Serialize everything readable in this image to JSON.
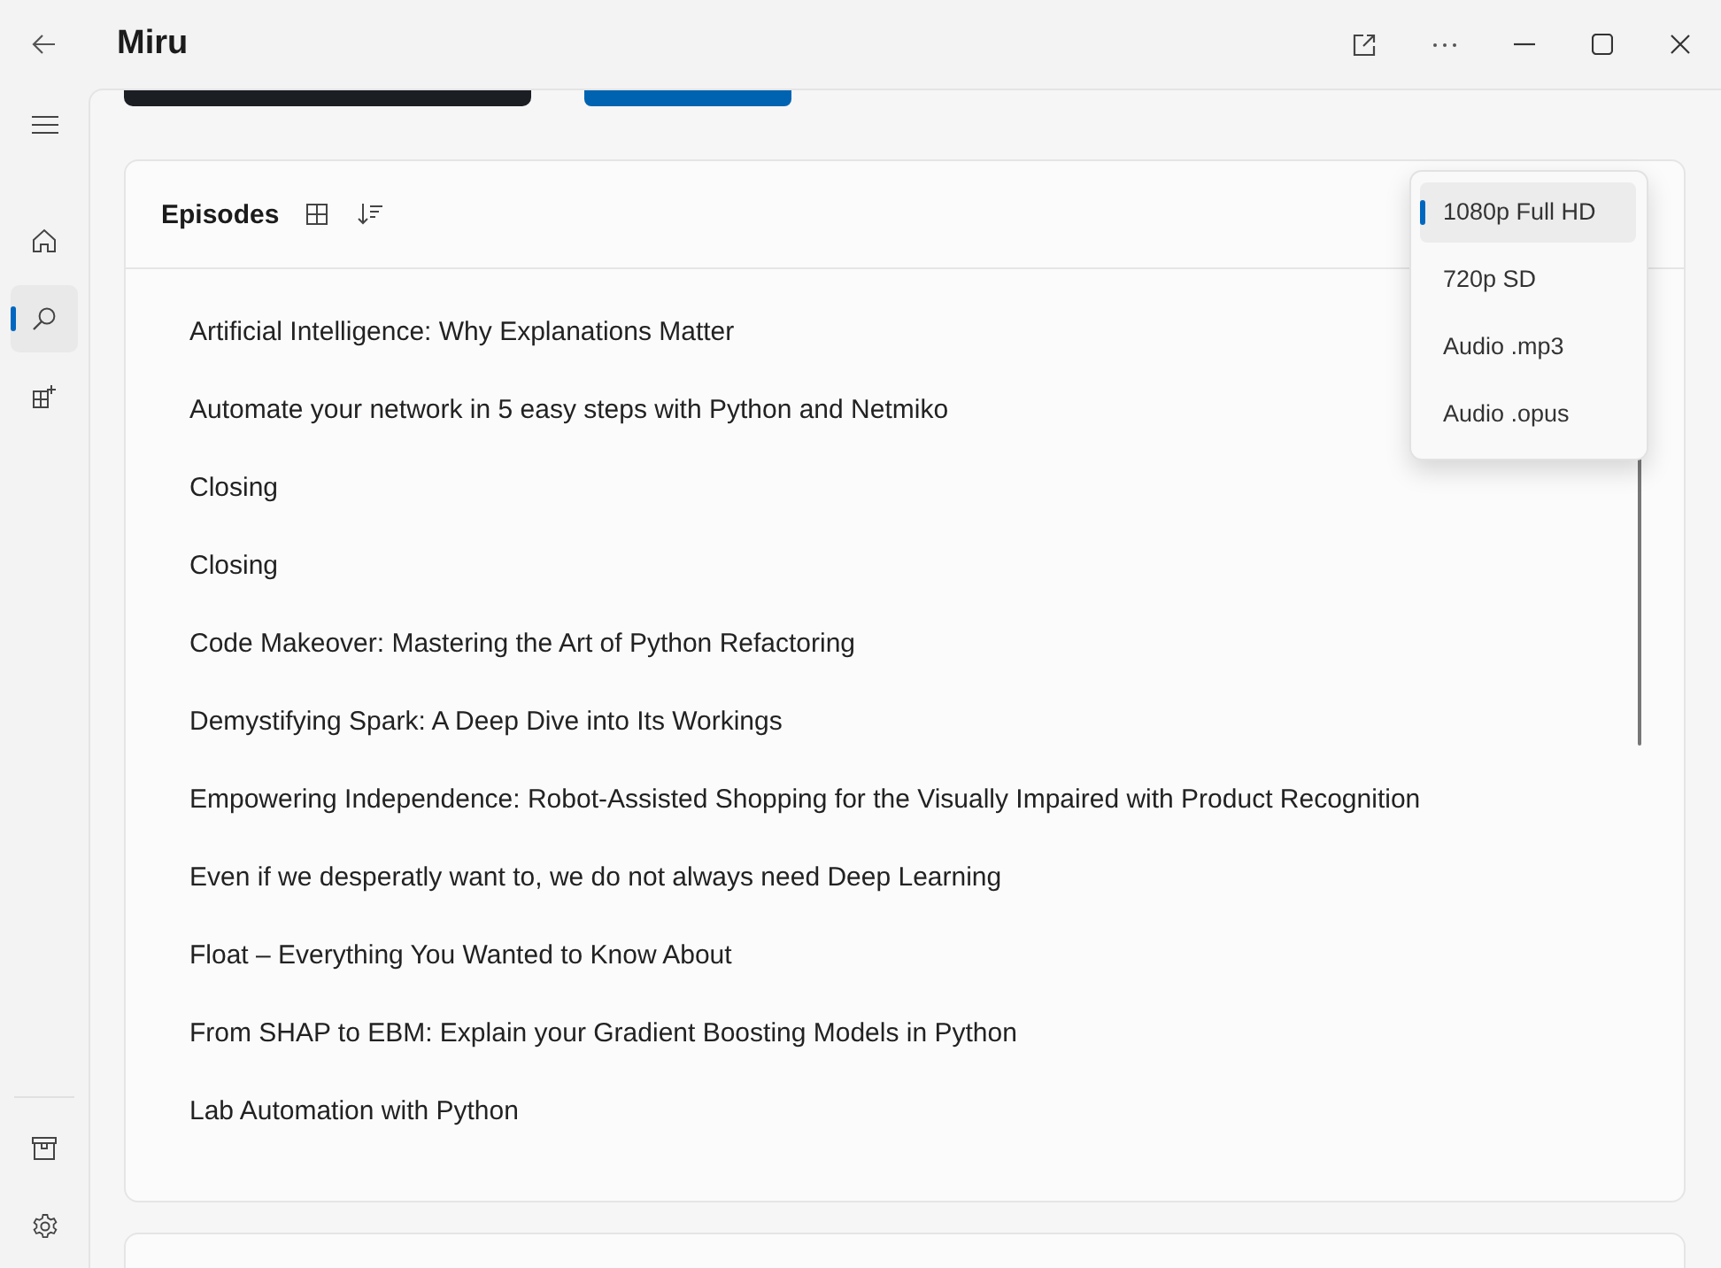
{
  "window": {
    "title": "Miru"
  },
  "sidebar": {
    "items": [
      {
        "kind": "menu",
        "selected": false
      },
      {
        "kind": "home",
        "selected": false
      },
      {
        "kind": "search",
        "selected": true
      },
      {
        "kind": "apps",
        "selected": false
      }
    ],
    "footer_items": [
      {
        "kind": "archive",
        "selected": false
      },
      {
        "kind": "settings",
        "selected": false
      }
    ]
  },
  "episodes": {
    "title": "Episodes",
    "rows": [
      "Artificial Intelligence: Why Explanations Matter",
      "Automate your network in 5 easy steps with Python and Netmiko",
      "Closing",
      "Closing",
      "Code Makeover: Mastering the Art of Python Refactoring",
      "Demystifying Spark: A Deep Dive into Its Workings",
      "Empowering Independence: Robot-Assisted Shopping for the Visually Impaired with Product Recognition",
      "Even if we desperatly want to, we do not always need Deep Learning",
      "Float – Everything You Wanted to Know About",
      "From SHAP to EBM: Explain your Gradient Boosting Models in Python",
      "Lab Automation with Python"
    ]
  },
  "quality_menu": {
    "items": [
      {
        "label": "1080p Full HD",
        "selected": true
      },
      {
        "label": "720p SD",
        "selected": false
      },
      {
        "label": "Audio .mp3",
        "selected": false
      },
      {
        "label": "Audio .opus",
        "selected": false
      }
    ]
  }
}
